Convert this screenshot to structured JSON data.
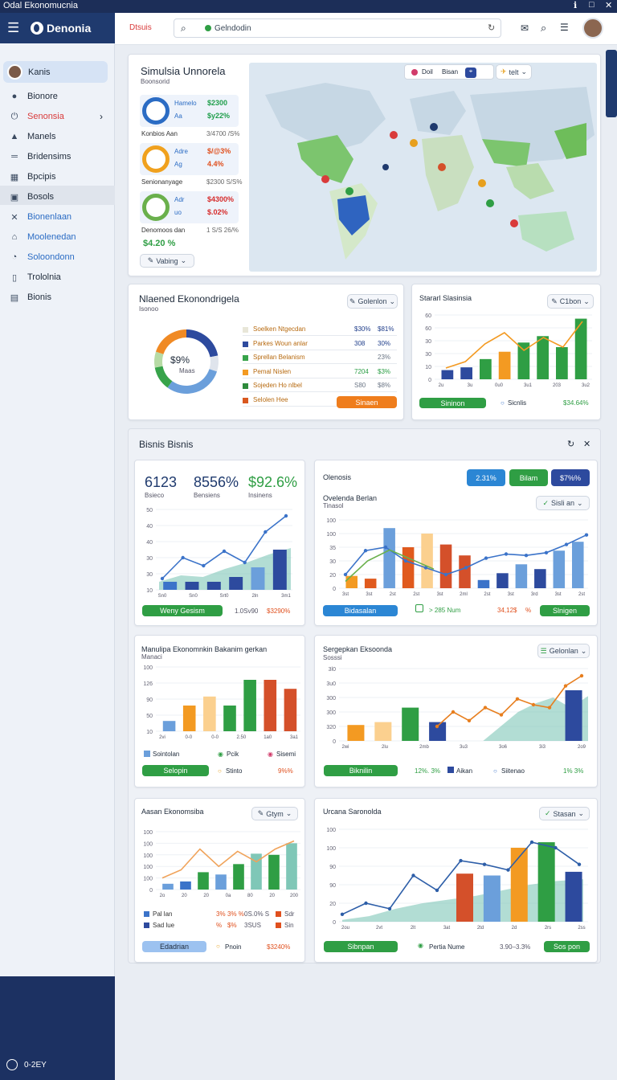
{
  "window": {
    "title": "Odal  Ekonomucnia"
  },
  "app": {
    "name": "Denonia"
  },
  "sidebar": {
    "user": "Kanis",
    "items": [
      {
        "label": "Bionore",
        "icon": "pin-icon"
      },
      {
        "label": "Senonsia",
        "icon": "power-icon"
      },
      {
        "label": "Manels",
        "icon": "warning-icon"
      },
      {
        "label": "Bridensims",
        "icon": "ruler-icon"
      },
      {
        "label": "Bpcipis",
        "icon": "calendar-icon"
      },
      {
        "label": "Bosols",
        "icon": "grid-icon"
      },
      {
        "label": "Bionenlaan",
        "icon": "tools-icon"
      },
      {
        "label": "Moolenedan",
        "icon": "home-icon"
      },
      {
        "label": "Soloondonn",
        "icon": "gauge-icon"
      },
      {
        "label": "Trololnia",
        "icon": "book-icon"
      },
      {
        "label": "Bionis",
        "icon": "chart-icon"
      }
    ],
    "footer": "0‑2EY"
  },
  "header": {
    "tag": "Dtsuis",
    "search_value": "Gelndodin"
  },
  "sim": {
    "title": "Simulsia Unnorela",
    "subtitle": "Boonsorid",
    "rows": [
      {
        "name": "Hamelo",
        "val1": "$2300",
        "sub": "Aa",
        "val2": "$y22%",
        "caption": "Konbios Aan",
        "caption_val": "3/4700 /S%",
        "ring": "#2b6cc4",
        "color": "#1f9e4b"
      },
      {
        "name": "Adre",
        "val1": "$/@3%",
        "sub": "Ag",
        "val2": "4.4%",
        "caption": "Senionanyage",
        "caption_val": "$2300 S/S%",
        "ring": "#f0a11e",
        "color": "#e0501e"
      },
      {
        "name": "Adr",
        "val1": "$4300%",
        "sub": "uo",
        "val2": "$.02%",
        "caption": "Denomoos dan",
        "caption_val": "1 S/S 26/%",
        "ring": "#6ab04c",
        "color": "#d62b2b"
      }
    ],
    "total": "$4.20 %",
    "dropdown": "Vabing"
  },
  "map": {
    "tab1": "Doil",
    "tab2": "Bisan",
    "tab3": "telt"
  },
  "alloc": {
    "title": "Nlaened Ekonondrigela",
    "subtitle": "Isonoo",
    "dropdown": "Golenlon",
    "donut_value": "$9%",
    "donut_label": "Maas",
    "rows": [
      {
        "label": "Soelken Ntgecdan",
        "v1": "$30%",
        "v2": "$81%",
        "color": "#e8e6d8",
        "c1": "#1f3d8a",
        "c2": "#1f3d8a"
      },
      {
        "label": "Parkes Woun anlar",
        "v1": "308",
        "v2": "30%",
        "color": "#2d4a9e",
        "c1": "#1f3d8a",
        "c2": "#1f3d8a"
      },
      {
        "label": "Sprellan Belanism",
        "v1": "",
        "v2": "23%",
        "color": "#37a34a",
        "c1": "#1f3d8a",
        "c2": "#6b7685"
      },
      {
        "label": "Pemal Nislen",
        "v1": "7204",
        "v2": "$3%",
        "color": "#f39a22",
        "c1": "#2a9d44",
        "c2": "#2a9d44"
      },
      {
        "label": "Sojeden Ho nlbel",
        "v1": "S80",
        "v2": "$8%",
        "color": "#2e8b3c",
        "c1": "#6b7685",
        "c2": "#6b7685"
      },
      {
        "label": "Selolen Hee",
        "v1": "",
        "v2": "",
        "color": "#d9581f",
        "c1": "#1f3d8a",
        "c2": "#1f3d8a"
      }
    ],
    "button": "Sinaen",
    "donut": [
      {
        "value": 22,
        "color": "#2d4a9e"
      },
      {
        "value": 8,
        "color": "#dfe4ec"
      },
      {
        "value": 30,
        "color": "#6b9fdb"
      },
      {
        "value": 12,
        "color": "#37a34a"
      },
      {
        "value": 8,
        "color": "#b7dba5"
      },
      {
        "value": 20,
        "color": "#f08a24"
      }
    ]
  },
  "stats": {
    "title": "Stararl Slasinsia",
    "dropdown": "C1bon",
    "y_ticks": [
      "60",
      "60",
      "30",
      "30",
      "10",
      "0"
    ],
    "x_ticks": [
      "2u",
      "3u",
      "0u0",
      "3u1",
      "203",
      "3u2"
    ],
    "footer_btn": "Sininon",
    "footer_mid": "Sicnlis",
    "footer_val": "$34.64%"
  },
  "bisnis": {
    "title": "Bisnis Bisnis"
  },
  "kpi": {
    "values": [
      "6123",
      "8556%",
      "$92.6%"
    ],
    "labels": [
      "Bsieco",
      "Bensiens",
      "Insinens"
    ],
    "y_ticks": [
      "50",
      "40",
      "40",
      "30",
      "30",
      "10"
    ],
    "x_ticks": [
      "Sn0",
      "Sn0",
      "Srt0",
      "2ln",
      "3m1"
    ],
    "btn": "Weny Gesism",
    "foot_mid": "1.0Sv90",
    "foot_val": "$3290%"
  },
  "overview": {
    "title": "Olenosis",
    "subtitle": "Ovelenda Berlan",
    "sub2": "Tinasol",
    "chips": [
      "2.31%",
      "Bilam",
      "$7%%"
    ],
    "dropdown": "Sisli an",
    "y_ticks": [
      "100",
      "100",
      "35",
      "30",
      "20",
      "0"
    ],
    "x_ticks": [
      "3st",
      "3st",
      "2st",
      "2st",
      "3st",
      "2ml",
      "2st",
      "3st",
      "3rd",
      "3st",
      "2st"
    ],
    "btn1": "Bidasalan",
    "mid": "> 285 Num",
    "val": "34,12$",
    "val2": "%",
    "btn2": "Slnigen"
  },
  "manufak": {
    "title": "Manulipa Ekonomnkin Bakanim gerkan",
    "subtitle": "Manaci",
    "y_ticks": [
      "100",
      "126",
      "90",
      "50",
      "10"
    ],
    "x_ticks": [
      "2vi",
      "0-0",
      "0-0",
      "2.50",
      "1a0",
      "3a1"
    ],
    "legend": [
      "Sointolan",
      "Pcik",
      "Sisemi"
    ],
    "btn": "Selopin",
    "foot_mid": "Stinto",
    "foot_val": "9%%"
  },
  "sergep": {
    "title": "Sergepkan Eksoonda",
    "subtitle": "Sosssi",
    "dropdown": "Gelonlan",
    "y_ticks": [
      "3l0",
      "3u0",
      "300",
      "300",
      "320",
      "0"
    ],
    "x_ticks": [
      "2wi",
      "2lu",
      "2mb",
      "3u3",
      "3o6",
      "3i3",
      "2o9"
    ],
    "btn": "Biknilin",
    "val1": "12%. 3%",
    "mid": "Aikan",
    "foot_mid": "Siitenao",
    "foot_val": "1% 3%"
  },
  "aasan": {
    "title": "Aasan Ekonomsiba",
    "dropdown": "Gtym",
    "y_ticks": [
      "100",
      "100",
      "100",
      "100",
      "100",
      "0"
    ],
    "x_ticks": [
      "2o",
      "20",
      "20",
      "0a",
      "80",
      "20",
      "200"
    ],
    "legend": [
      {
        "a": "Pal lan",
        "b": "3%",
        "c": "3% %",
        "d": "0S.0% S",
        "e": "Sdr"
      },
      {
        "a": "Sad lue",
        "b": "%",
        "c": "$%",
        "d": "3SUS",
        "e": "Sin"
      }
    ],
    "btn": "Edadrian",
    "mid": "Pnoin",
    "val": "$3240%"
  },
  "urana": {
    "title": "Urcana Saronolda",
    "y_ticks": [
      "100",
      "100",
      "90",
      "90",
      "20",
      "0"
    ],
    "x_ticks": [
      "2ou",
      "2vt",
      "2lt",
      "3at",
      "2td",
      "2d",
      "2rs",
      "2ss"
    ],
    "btn1": "Sibnpan",
    "mid": "Pertia Nume",
    "val": "3.90–3.3%",
    "btn2": "Sos pon"
  },
  "colors": {
    "navy": "#1f3a6e",
    "green": "#2f9e44",
    "orange": "#f39a22",
    "blue": "#3b73c9",
    "teal": "#7fc7b7",
    "red": "#d4502a"
  },
  "chart_data": [
    {
      "type": "bar",
      "title": "Stararl Slasinsia",
      "categories": [
        "2u",
        "3u",
        "0u0",
        "3u1",
        "203",
        "3u2"
      ],
      "values": [
        10,
        13,
        22,
        30,
        40,
        47,
        35,
        60
      ]
    },
    {
      "type": "line",
      "title": "Bisnis KPI",
      "values": [
        12,
        24,
        19,
        32,
        22,
        34,
        52
      ]
    },
    {
      "type": "bar",
      "title": "Olenosis",
      "values": [
        88,
        26,
        80,
        60,
        48,
        20,
        12,
        22,
        35,
        28,
        40,
        60
      ]
    }
  ]
}
